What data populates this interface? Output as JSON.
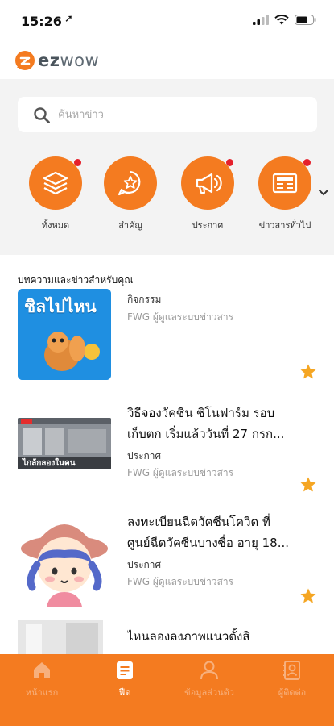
{
  "status_bar": {
    "time": "15:26"
  },
  "app": {
    "logo_text_bold": "ez",
    "logo_text_light": "wow"
  },
  "search": {
    "placeholder": "ค้นหาข่าว"
  },
  "categories": [
    {
      "label": "ทั้งหมด",
      "icon": "layers-icon",
      "has_dot": true
    },
    {
      "label": "สำคัญ",
      "icon": "star-bubble-icon",
      "has_dot": false
    },
    {
      "label": "ประกาศ",
      "icon": "megaphone-icon",
      "has_dot": true
    },
    {
      "label": "ข่าวสารทั่วไป",
      "icon": "newspaper-icon",
      "has_dot": true
    }
  ],
  "section": {
    "title": "บทความและข่าวสำหรับคุณ"
  },
  "feed": [
    {
      "title": "",
      "category": "กิจกรรม",
      "author": "FWG ผู้ดูแลระบบข่าวสาร",
      "thumb_text": "ชิลไปไหน",
      "starred": true
    },
    {
      "title_line1": "วิธีจองวัคซีน ซิโนฟาร์ม รอบ",
      "title_line2": "เก็บตก เริ่มแล้ววันที่ 27 กรก...",
      "category": "ประกาศ",
      "author": "FWG ผู้ดูแลระบบข่าวสาร",
      "thumb_text": "ไกล้กลองในคน",
      "starred": true
    },
    {
      "title_line1": "ลงทะเบียนฉีดวัคซีนโควิด ที่",
      "title_line2": "ศูนย์ฉีดวัคซีนบางซื่อ อายุ 18...",
      "category": "ประกาศ",
      "author": "FWG ผู้ดูแลระบบข่าวสาร",
      "starred": true
    },
    {
      "title_line1": "ไหนลองลงภาพแนวตั้งสิ",
      "category": "",
      "author": "",
      "starred": false
    }
  ],
  "bottom_nav": [
    {
      "label": "หน้าแรก",
      "icon": "home-icon",
      "active": false
    },
    {
      "label": "ฟีด",
      "icon": "feed-icon",
      "active": true
    },
    {
      "label": "ข้อมูลส่วนตัว",
      "icon": "profile-icon",
      "active": false
    },
    {
      "label": "ผู้ติดต่อ",
      "icon": "contacts-icon",
      "active": false
    }
  ],
  "colors": {
    "accent": "#f47b20",
    "dot": "#e5202b",
    "star": "#f5a623",
    "background_top": "#f3f3f3"
  }
}
